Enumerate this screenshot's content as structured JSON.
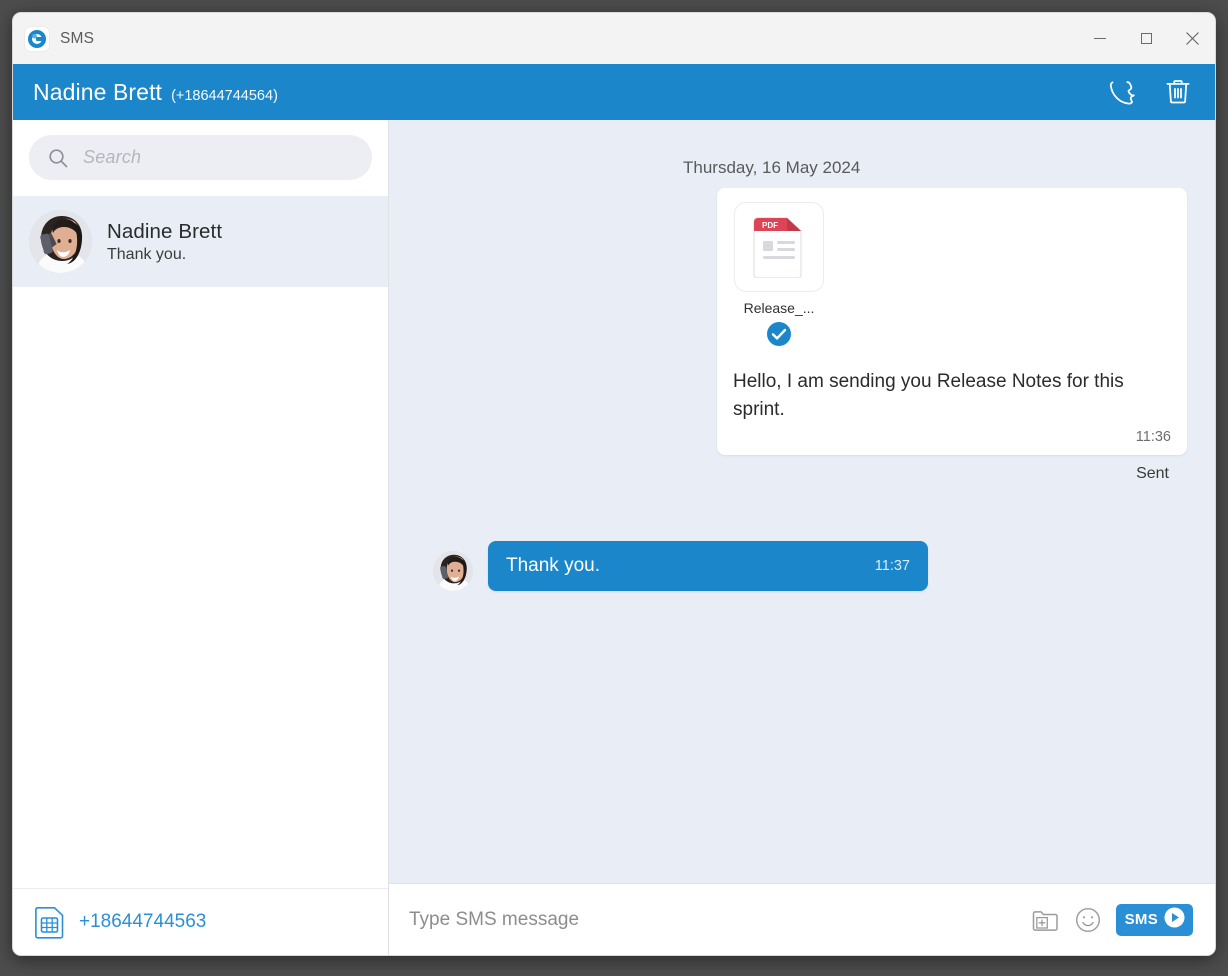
{
  "window": {
    "app_title": "SMS",
    "logo_icon": "g-logo-icon",
    "controls": {
      "minimize": "minimize-icon",
      "maximize": "maximize-icon",
      "close": "close-icon"
    }
  },
  "conversation_header": {
    "contact_name": "Nadine Brett",
    "contact_phone": "(+18644744564)",
    "call_icon": "phone-icon",
    "delete_icon": "trash-icon",
    "background_color": "#1b87ca"
  },
  "sidebar": {
    "search": {
      "placeholder": "Search",
      "icon": "search-icon"
    },
    "contacts": [
      {
        "name": "Nadine Brett",
        "preview": "Thank you.",
        "avatar": "contact-avatar",
        "selected": true
      }
    ],
    "sim": {
      "icon": "sim-card-icon",
      "number": "+18644744563",
      "color": "#2a8fd4"
    }
  },
  "chat": {
    "date_divider": "Thursday, 16 May 2024",
    "messages": [
      {
        "direction": "outgoing",
        "attachment": {
          "type": "pdf",
          "icon_label": "PDF",
          "filename": "Release_...",
          "status_icon": "check-circle-icon"
        },
        "text": "Hello, I am sending you Release Notes for this sprint.",
        "time": "11:36",
        "status": "Sent"
      },
      {
        "direction": "incoming",
        "text": "Thank you.",
        "time": "11:37",
        "avatar": "contact-avatar"
      }
    ]
  },
  "compose": {
    "placeholder": "Type SMS message",
    "attach_icon": "folder-plus-icon",
    "emoji_icon": "smiley-icon",
    "send_label": "SMS",
    "send_icon": "send-arrow-icon",
    "send_color": "#2a8fd4"
  }
}
